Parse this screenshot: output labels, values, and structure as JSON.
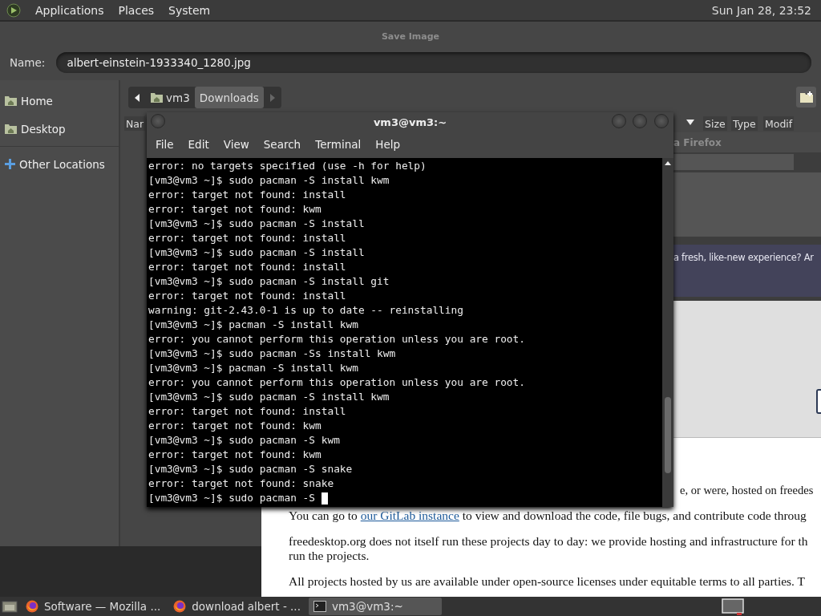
{
  "top_panel": {
    "menus": [
      "Applications",
      "Places",
      "System"
    ],
    "clock": "Sun Jan 28, 23:52"
  },
  "save_dialog": {
    "title": "Save Image",
    "name_label": "Name:",
    "name_value": "albert-einstein-1933340_1280.jpg",
    "places": [
      {
        "label": "Home",
        "kind": "folder"
      },
      {
        "label": "Desktop",
        "kind": "folder"
      },
      {
        "label": "Other Locations",
        "kind": "plus"
      }
    ],
    "path": [
      {
        "label": "vm3",
        "selected": false
      },
      {
        "label": "Downloads",
        "selected": true
      }
    ],
    "columns": [
      "Nar",
      "Size",
      "Type",
      "Modif"
    ]
  },
  "browser": {
    "tab_title": "a Firefox",
    "notification": "a fresh, like-new experience? Ar",
    "paragraphs": [
      {
        "lines": [
          "e, or were, hosted on freedes"
        ]
      },
      {
        "before": "You can go to ",
        "link": "our GitLab instance",
        "after": " to view and download the code, file bugs, and contribute code throug"
      },
      {
        "lines": [
          "freedesktop.org does not itself run these projects day to day: we provide hosting and infrastructure for th",
          "run the projects."
        ]
      },
      {
        "lines": [
          "All projects hosted by us are available under open-source licenses under equitable terms to all parties. T"
        ]
      }
    ]
  },
  "terminal": {
    "title": "vm3@vm3:~",
    "menus": [
      "File",
      "Edit",
      "View",
      "Search",
      "Terminal",
      "Help"
    ],
    "lines": [
      "error: no targets specified (use -h for help)",
      "[vm3@vm3 ~]$ sudo pacman -S install kwm",
      "error: target not found: install",
      "error: target not found: kwm",
      "[vm3@vm3 ~]$ sudo pacman -S install",
      "error: target not found: install",
      "[vm3@vm3 ~]$ sudo pacman -S install",
      "error: target not found: install",
      "[vm3@vm3 ~]$ sudo pacman -S install git",
      "error: target not found: install",
      "warning: git-2.43.0-1 is up to date -- reinstalling",
      "[vm3@vm3 ~]$ pacman -S install kwm",
      "error: you cannot perform this operation unless you are root.",
      "[vm3@vm3 ~]$ sudo pacman -Ss install kwm",
      "[vm3@vm3 ~]$ pacman -S install kwm",
      "error: you cannot perform this operation unless you are root.",
      "[vm3@vm3 ~]$ sudo pacman -S install kwm",
      "error: target not found: install",
      "error: target not found: kwm",
      "[vm3@vm3 ~]$ sudo pacman -S kwm",
      "error: target not found: kwm",
      "[vm3@vm3 ~]$ sudo pacman -S snake",
      "error: target not found: snake",
      "[vm3@vm3 ~]$ sudo pacman -S "
    ]
  },
  "taskbar": {
    "items": [
      {
        "label": "Software — Mozilla ...",
        "kind": "firefox",
        "selected": false
      },
      {
        "label": "download albert - ...",
        "kind": "firefox",
        "selected": false
      },
      {
        "label": "vm3@vm3:~",
        "kind": "terminal",
        "selected": true
      }
    ]
  }
}
